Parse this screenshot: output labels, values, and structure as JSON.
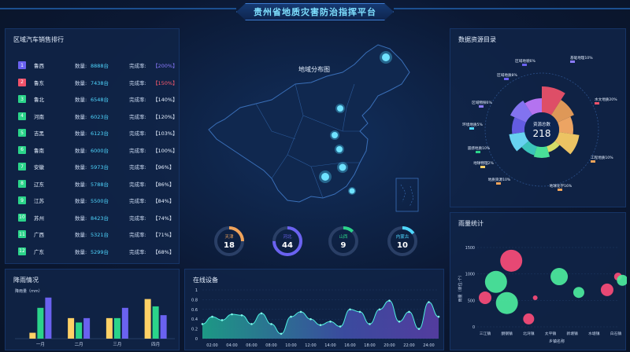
{
  "header": {
    "title": "贵州省地质灾害防治指挥平台"
  },
  "ranking": {
    "title": "区域汽车销售排行",
    "qty_label": "数量:",
    "rate_label": "完成率:",
    "rows": [
      {
        "rank": "1",
        "name": "鲁西",
        "qty": "8888台",
        "rate": "【200%】",
        "rank_color": "#6a62f0",
        "rate_color": "#8c7bff"
      },
      {
        "rank": "2",
        "name": "鲁东",
        "qty": "7438台",
        "rate": "【150%】",
        "rank_color": "#f0526a",
        "rate_color": "#ff5b6e"
      },
      {
        "rank": "3",
        "name": "鲁北",
        "qty": "6548台",
        "rate": "【140%】",
        "rank_color": "#2bd48a",
        "rate_color": "#e6f0ff"
      },
      {
        "rank": "4",
        "name": "河南",
        "qty": "6023台",
        "rate": "【120%】",
        "rank_color": "#2bd48a",
        "rate_color": "#e6f0ff"
      },
      {
        "rank": "5",
        "name": "吉黑",
        "qty": "6123台",
        "rate": "【103%】",
        "rank_color": "#2bd48a",
        "rate_color": "#e6f0ff"
      },
      {
        "rank": "6",
        "name": "鲁南",
        "qty": "6000台",
        "rate": "【100%】",
        "rank_color": "#2bd48a",
        "rate_color": "#e6f0ff"
      },
      {
        "rank": "7",
        "name": "安徽",
        "qty": "5973台",
        "rate": "【96%】",
        "rank_color": "#2bd48a",
        "rate_color": "#e6f0ff"
      },
      {
        "rank": "8",
        "name": "辽东",
        "qty": "5788台",
        "rate": "【86%】",
        "rank_color": "#2bd48a",
        "rate_color": "#e6f0ff"
      },
      {
        "rank": "9",
        "name": "江苏",
        "qty": "5500台",
        "rate": "【84%】",
        "rank_color": "#2bd48a",
        "rate_color": "#e6f0ff"
      },
      {
        "rank": "10",
        "name": "苏州",
        "qty": "8423台",
        "rate": "【74%】",
        "rank_color": "#2bd48a",
        "rate_color": "#e6f0ff"
      },
      {
        "rank": "11",
        "name": "广西",
        "qty": "5321台",
        "rate": "【71%】",
        "rank_color": "#2bd48a",
        "rate_color": "#e6f0ff"
      },
      {
        "rank": "12",
        "name": "广东",
        "qty": "5299台",
        "rate": "【68%】",
        "rank_color": "#2bd48a",
        "rate_color": "#e6f0ff"
      }
    ]
  },
  "map": {
    "title": "地域分布图",
    "gauges": [
      {
        "name": "天津",
        "value": "18",
        "color": "#f0a35a",
        "fraction": 0.25
      },
      {
        "name": "河北",
        "value": "44",
        "color": "#6a62f0",
        "fraction": 0.75
      },
      {
        "name": "山西",
        "value": "9",
        "color": "#2bd48a",
        "fraction": 0.12
      },
      {
        "name": "内蒙古",
        "value": "10",
        "color": "#4fd7ff",
        "fraction": 0.15
      }
    ]
  },
  "resources": {
    "title": "数据资源目录",
    "center_label": "资源总数",
    "center_value": "218",
    "labels": [
      {
        "text": "基础地理10%",
        "color": "#8c7bff"
      },
      {
        "text": "区域地貌6%",
        "color": "#6a62f0"
      },
      {
        "text": "区域地质8%",
        "color": "#6a62f0"
      },
      {
        "text": "区域物探6%",
        "color": "#8c7bff"
      },
      {
        "text": "环境地质5%",
        "color": "#4fd7ff"
      },
      {
        "text": "遥感地质10%",
        "color": "#2bd48a"
      },
      {
        "text": "地球物理2%",
        "color": "#ffd166"
      },
      {
        "text": "地质资源10%",
        "color": "#f0a35a"
      },
      {
        "text": "水文地质20%",
        "color": "#f0526a"
      },
      {
        "text": "工程地质10%",
        "color": "#f0a35a"
      },
      {
        "text": "地球化学16%",
        "color": "#f0a35a"
      }
    ]
  },
  "rain": {
    "title": "降雨情况",
    "unit": "降雨量（mm）",
    "colors": [
      "#ffd166",
      "#2bd48a",
      "#6a62f0"
    ],
    "chart_data": {
      "type": "bar",
      "categories": [
        "一月",
        "二月",
        "三月",
        "四月"
      ],
      "series": [
        {
          "values": [
            4,
            14,
            14,
            27
          ]
        },
        {
          "values": [
            21,
            11,
            14,
            22
          ]
        },
        {
          "values": [
            28,
            14,
            21,
            16
          ]
        }
      ],
      "ylim": [
        0,
        30
      ]
    }
  },
  "online": {
    "title": "在线设备",
    "chart_data": {
      "type": "area",
      "x": [
        "02:00",
        "04:00",
        "06:00",
        "08:00",
        "10:00",
        "12:00",
        "14:00",
        "16:00",
        "18:00",
        "20:00",
        "22:00",
        "24:00"
      ],
      "x_label_values": [
        2,
        4,
        6,
        8,
        10,
        12,
        14,
        16,
        18,
        20,
        22,
        24
      ],
      "y_ticks": [
        "0",
        "0.2",
        "0.4",
        "0.6",
        "0.8",
        "1"
      ],
      "ylim": [
        0,
        1
      ],
      "xlim": [
        1,
        25
      ],
      "points": [
        [
          1,
          0.3
        ],
        [
          2,
          0.45
        ],
        [
          3,
          0.38
        ],
        [
          4,
          0.5
        ],
        [
          5,
          0.48
        ],
        [
          6,
          0.3
        ],
        [
          7,
          0.52
        ],
        [
          8,
          0.3
        ],
        [
          9,
          0.1
        ],
        [
          10,
          0.45
        ],
        [
          11,
          0.55
        ],
        [
          12,
          0.4
        ],
        [
          13,
          0.28
        ],
        [
          14,
          0.35
        ],
        [
          15,
          0.25
        ],
        [
          16,
          0.6
        ],
        [
          17,
          0.55
        ],
        [
          18,
          0.3
        ],
        [
          19,
          0.6
        ],
        [
          20,
          0.78
        ],
        [
          21,
          0.35
        ],
        [
          22,
          0.55
        ],
        [
          23,
          0.2
        ],
        [
          24,
          0.75
        ],
        [
          25,
          0.45
        ]
      ]
    }
  },
  "rainfall_stats": {
    "title": "雨量统计",
    "ylabel": "雨量（单位:个）",
    "xlabel": "乡镇名称",
    "chart_data": {
      "type": "scatter",
      "categories": [
        "三江镇",
        "酮钢镇",
        "北湾镇",
        "太平镇",
        "新塘镇",
        "水塘镇",
        "白石镇"
      ],
      "y_ticks": [
        "0",
        "500",
        "1000",
        "1500"
      ],
      "ylim": [
        0,
        1500
      ],
      "points": [
        {
          "x": 0,
          "y": 550,
          "r": 8,
          "color": "#ff4d7a"
        },
        {
          "x": 0.5,
          "y": 850,
          "r": 14,
          "color": "#4ef0a0"
        },
        {
          "x": 1,
          "y": 450,
          "r": 14,
          "color": "#4ef0a0"
        },
        {
          "x": 1.2,
          "y": 1250,
          "r": 14,
          "color": "#ff4d7a"
        },
        {
          "x": 2,
          "y": 150,
          "r": 7,
          "color": "#ff4d7a"
        },
        {
          "x": 2.3,
          "y": 550,
          "r": 3,
          "color": "#ff4d7a"
        },
        {
          "x": 3.4,
          "y": 950,
          "r": 11,
          "color": "#4ef0a0"
        },
        {
          "x": 4.3,
          "y": 650,
          "r": 7,
          "color": "#4ef0a0"
        },
        {
          "x": 5.6,
          "y": 700,
          "r": 8,
          "color": "#ff4d7a"
        },
        {
          "x": 6.1,
          "y": 950,
          "r": 5,
          "color": "#ff4d7a"
        },
        {
          "x": 6.3,
          "y": 880,
          "r": 7,
          "color": "#4ef0a0"
        }
      ]
    }
  }
}
